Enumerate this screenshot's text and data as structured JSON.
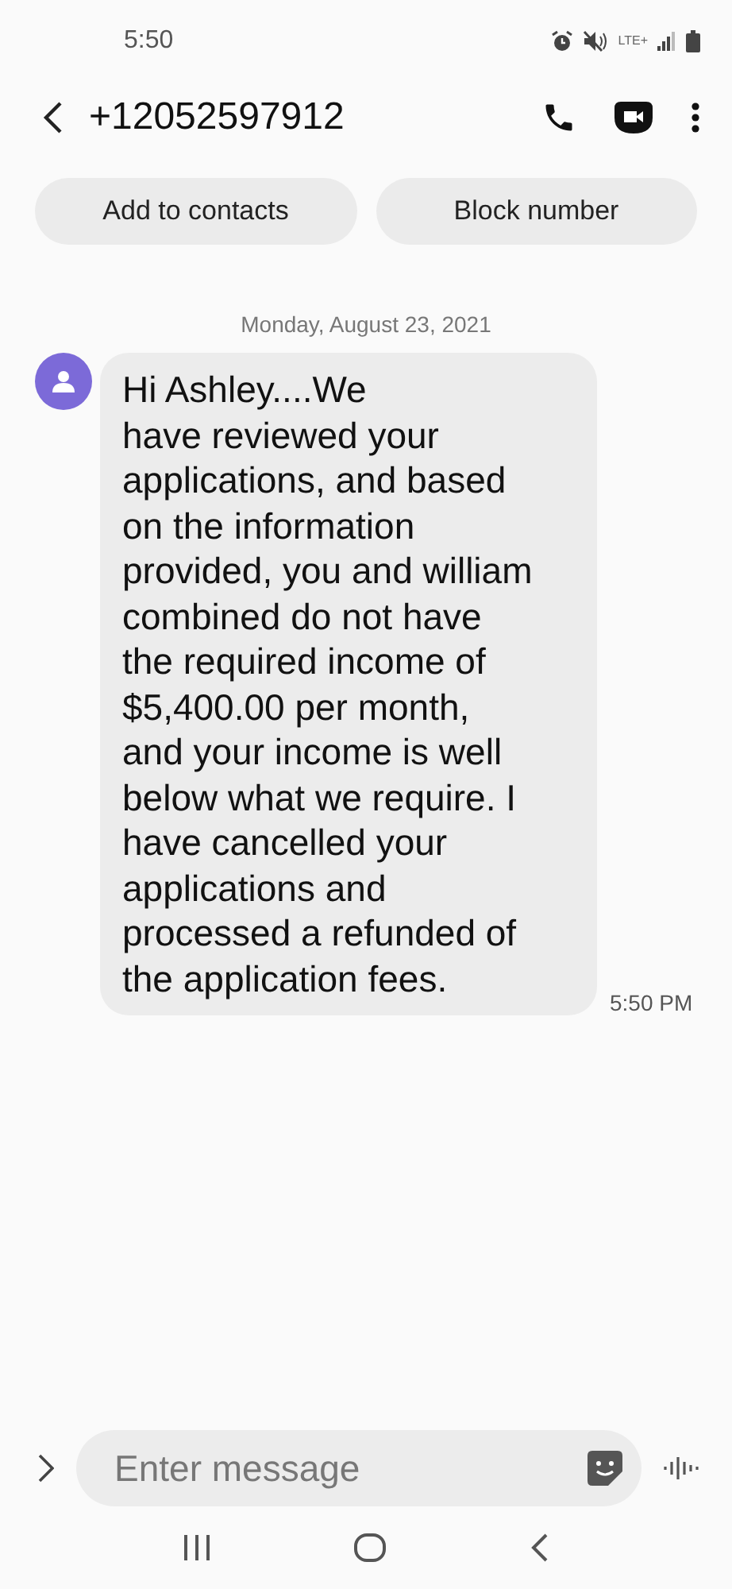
{
  "status_bar": {
    "time": "5:50",
    "network": "LTE+"
  },
  "header": {
    "title": "+12052597912"
  },
  "actions": [
    "Add to contacts",
    "Block number"
  ],
  "thread": {
    "date": "Monday, August 23, 2021",
    "messages": [
      {
        "kind": "incoming",
        "text": "Hi Ashley....We\nhave reviewed your applications, and based on the information provided, you and william combined do not have the required income of $5,400.00 per month, and your income is well below what we require. I have cancelled your applications and processed a refunded of the application fees.",
        "time": "5:50 PM"
      }
    ]
  },
  "composer": {
    "placeholder": "Enter message"
  }
}
